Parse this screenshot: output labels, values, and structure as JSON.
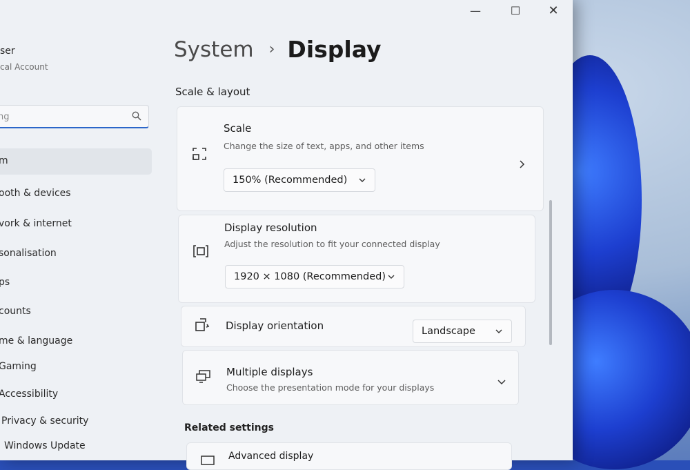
{
  "window": {
    "caption": {
      "minimize": "—",
      "maximize": "☐",
      "close": "✕"
    }
  },
  "user": {
    "name": "ser",
    "account": "cal Account"
  },
  "search": {
    "placeholder": "ng"
  },
  "sidebar": {
    "items": [
      {
        "label": "m",
        "active": true
      },
      {
        "label": "ooth & devices"
      },
      {
        "label": "vork & internet"
      },
      {
        "label": "sonalisation"
      },
      {
        "label": "ps"
      },
      {
        "label": "counts"
      },
      {
        "label": "me & language"
      },
      {
        "label": "Gaming"
      },
      {
        "label": "Accessibility"
      },
      {
        "label": "Privacy & security"
      },
      {
        "label": "Windows Update"
      }
    ]
  },
  "header": {
    "parent": "System",
    "separator": "›",
    "current": "Display"
  },
  "scale_layout": {
    "title": "Scale & layout",
    "scale": {
      "title": "Scale",
      "description": "Change the size of text, apps, and other items",
      "value": "150% (Recommended)"
    },
    "resolution": {
      "title": "Display resolution",
      "description": "Adjust the resolution to fit your connected display",
      "value": "1920 × 1080 (Recommended)"
    },
    "orientation": {
      "title": "Display orientation",
      "value": "Landscape"
    },
    "multiple": {
      "title": "Multiple displays",
      "description": "Choose the presentation mode for your displays"
    }
  },
  "related": {
    "title": "Related settings",
    "advanced": {
      "title": "Advanced display"
    }
  },
  "colors": {
    "accent": "#2b66c9",
    "window_bg": "#eef1f5",
    "card_bg": "#f7f8fa"
  }
}
